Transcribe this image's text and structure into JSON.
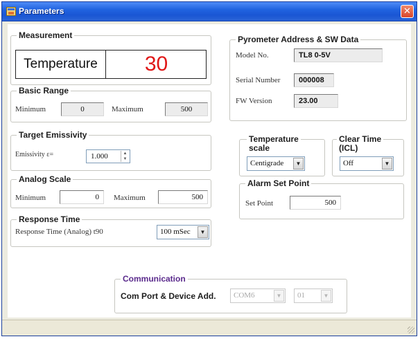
{
  "window": {
    "title": "Parameters",
    "close_label": "✕"
  },
  "measurement": {
    "title": "Measurement",
    "label": "Temperature",
    "value": "30"
  },
  "basic_range": {
    "title": "Basic Range",
    "minimum_label": "Minimum",
    "minimum_value": "0",
    "maximum_label": "Maximum",
    "maximum_value": "500"
  },
  "target_emissivity": {
    "title": "Target Emissivity",
    "label": "Emissivity ε=",
    "value": "1.000"
  },
  "analog_scale": {
    "title": "Analog Scale",
    "minimum_label": "Minimum",
    "minimum_value": "0",
    "maximum_label": "Maximum",
    "maximum_value": "500"
  },
  "response_time": {
    "title": "Response Time",
    "label": "Response Time  (Analog)  t90",
    "selected": "100 mSec"
  },
  "pyrometer": {
    "title": "Pyrometer Address & SW Data",
    "model_label": "Model No.",
    "model_value": "TL8 0-5V",
    "serial_label": "Serial Number",
    "serial_value": "000008",
    "fw_label": "FW Version",
    "fw_value": "23.00"
  },
  "temperature_scale": {
    "title_line1": "Temperature",
    "title_line2": "scale",
    "selected": "Centigrade"
  },
  "clear_time": {
    "title_line1": "Clear Time",
    "title_line2": "(ICL)",
    "selected": "Off"
  },
  "alarm": {
    "title": "Alarm Set Point",
    "label": "Set Point",
    "value": "500"
  },
  "communication": {
    "title": "Communication",
    "label": "Com Port & Device Add.",
    "port": "COM6",
    "address": "01"
  },
  "colors": {
    "titlebar": "#2163e0",
    "value_red": "#e01818",
    "communication_title": "#5a2a8c"
  }
}
